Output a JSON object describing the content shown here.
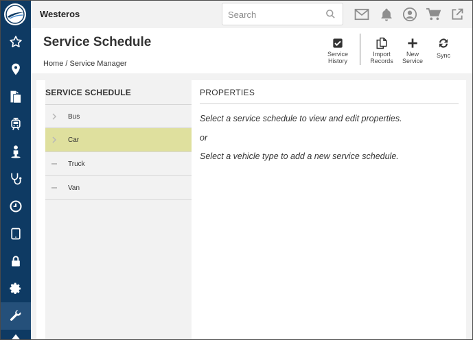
{
  "app": {
    "name": "Westeros"
  },
  "search": {
    "placeholder": "Search"
  },
  "topbar_icons": [
    "mail-icon",
    "bell-icon",
    "user-icon",
    "cart-icon",
    "external-link-icon"
  ],
  "sidebar": {
    "items": [
      {
        "icon": "star-icon"
      },
      {
        "icon": "location-pin-icon"
      },
      {
        "icon": "documents-icon"
      },
      {
        "icon": "tram-icon"
      },
      {
        "icon": "person-icon"
      },
      {
        "icon": "stethoscope-icon"
      },
      {
        "icon": "clock-icon"
      },
      {
        "icon": "tablet-icon"
      },
      {
        "icon": "lock-icon"
      },
      {
        "icon": "gear-icon"
      },
      {
        "icon": "wrench-icon",
        "active": true
      }
    ]
  },
  "header": {
    "title": "Service Schedule",
    "breadcrumb": "Home / Service Manager"
  },
  "toolbar": {
    "service_history": [
      "Service",
      "History"
    ],
    "import_records": [
      "Import",
      "Records"
    ],
    "new_service": [
      "New",
      "Service"
    ],
    "sync": "Sync"
  },
  "schedule": {
    "title": "SERVICE SCHEDULE",
    "items": [
      {
        "label": "Bus",
        "marker": "chevron",
        "selected": false
      },
      {
        "label": "Car",
        "marker": "chevron",
        "selected": true
      },
      {
        "label": "Truck",
        "marker": "dash",
        "selected": false
      },
      {
        "label": "Van",
        "marker": "dash",
        "selected": false
      }
    ]
  },
  "properties": {
    "title": "PROPERTIES",
    "message1": "Select a service schedule to view and edit properties.",
    "or": "or",
    "message2": "Select a vehicle type to add a new service schedule."
  },
  "colors": {
    "sidebar": "#0e3a63",
    "sidebar_active": "#25507a",
    "selected_row": "#dfe09e"
  }
}
